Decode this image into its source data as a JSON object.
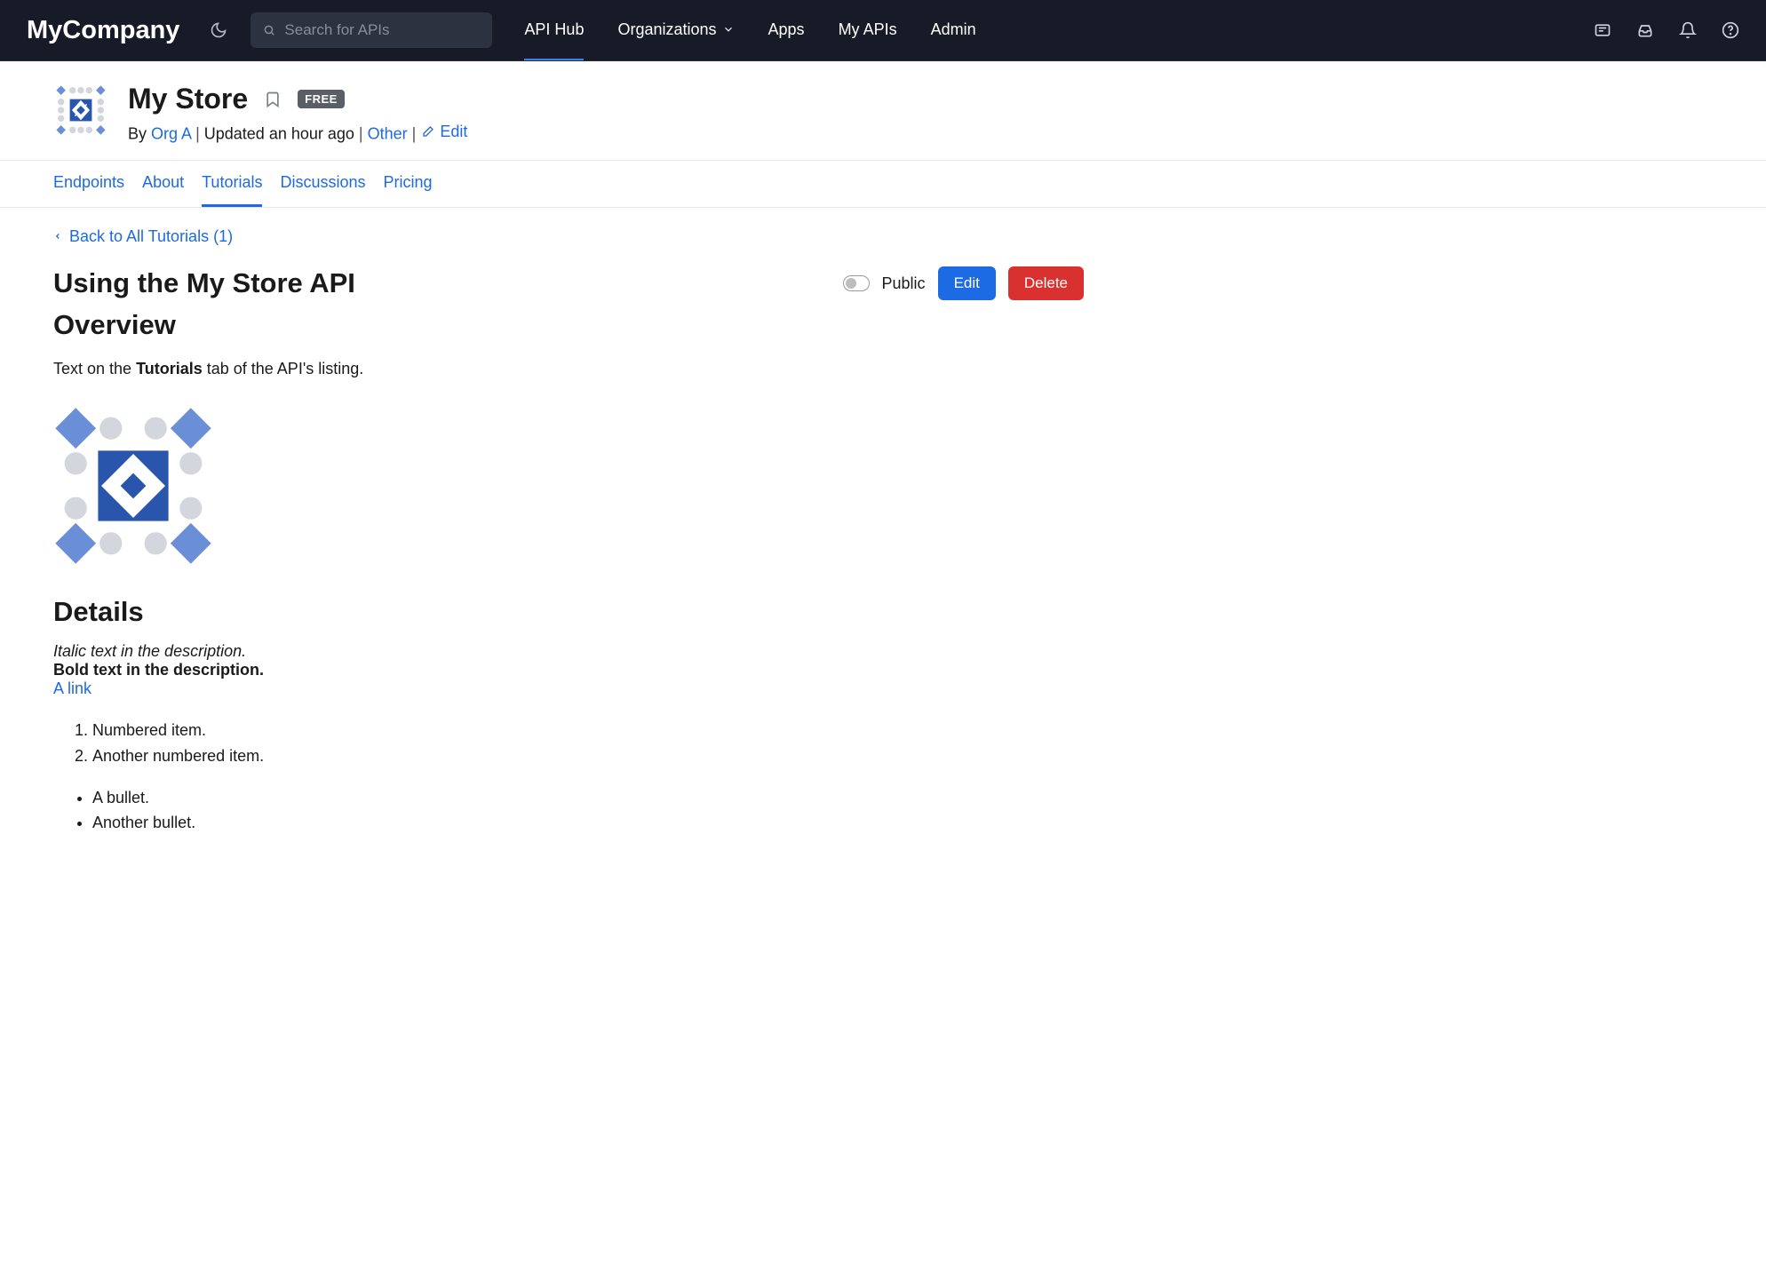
{
  "brand": "MyCompany",
  "search": {
    "placeholder": "Search for APIs"
  },
  "nav": {
    "api_hub": "API Hub",
    "organizations": "Organizations",
    "apps": "Apps",
    "my_apis": "My APIs",
    "admin": "Admin"
  },
  "api": {
    "title": "My Store",
    "badge": "FREE",
    "by_label": "By",
    "org": "Org A",
    "updated": "Updated an hour ago",
    "category": "Other",
    "edit": "Edit"
  },
  "tabs": {
    "endpoints": "Endpoints",
    "about": "About",
    "tutorials": "Tutorials",
    "discussions": "Discussions",
    "pricing": "Pricing"
  },
  "back_link": "Back to All Tutorials (1)",
  "tutorial": {
    "title": "Using the My Store API",
    "public_label": "Public",
    "edit_btn": "Edit",
    "delete_btn": "Delete"
  },
  "article": {
    "overview_h": "Overview",
    "overview_pre": "Text on the ",
    "overview_bold": "Tutorials",
    "overview_post": " tab of the API's listing.",
    "details_h": "Details",
    "italic_line": "Italic text in the description.",
    "bold_line": "Bold text in the description.",
    "link_line": "A link",
    "numbered": [
      "Numbered item.",
      "Another numbered item."
    ],
    "bullets": [
      "A bullet.",
      "Another bullet."
    ]
  }
}
